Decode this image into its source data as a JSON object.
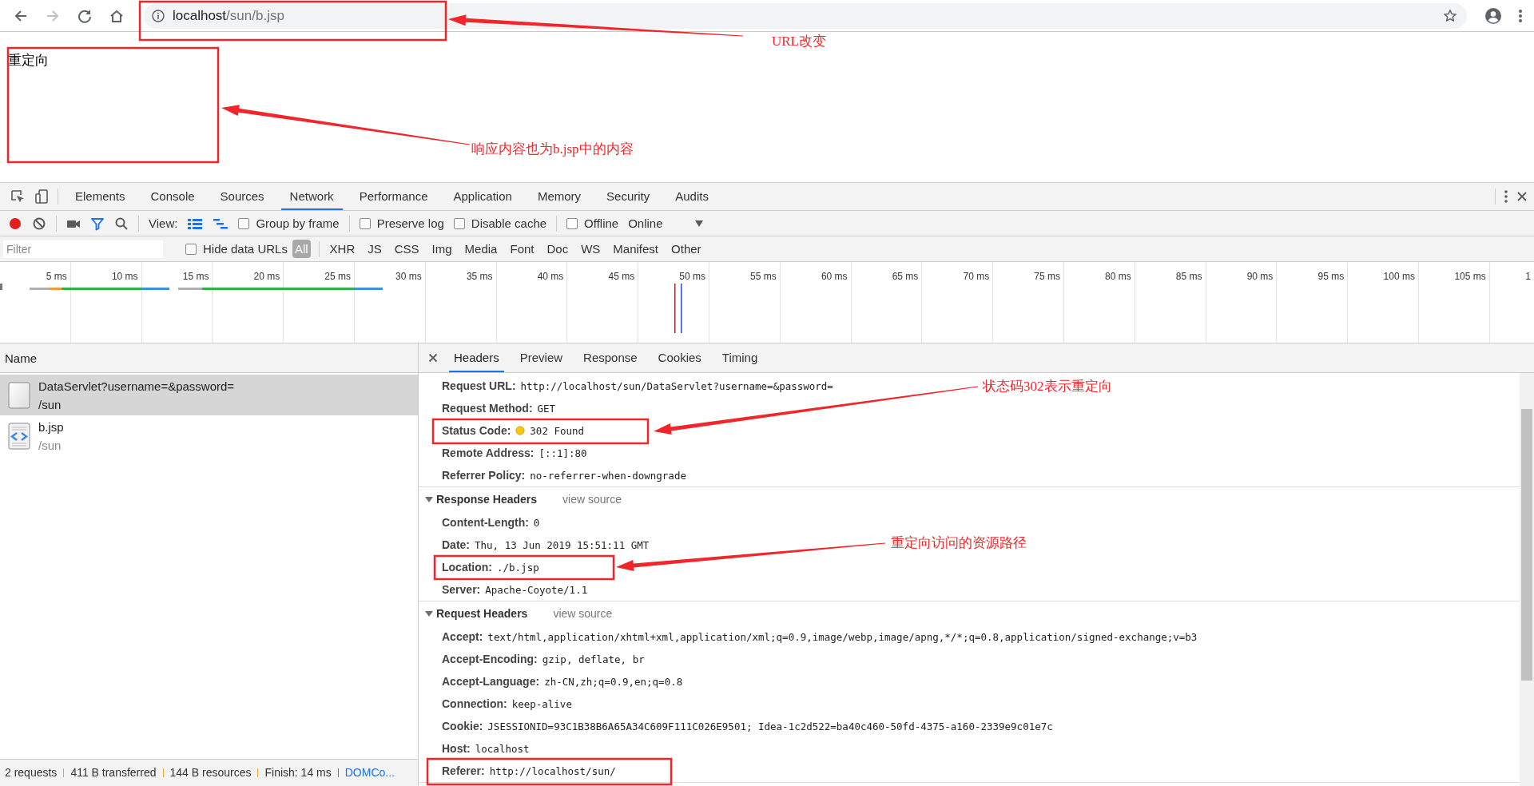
{
  "browser": {
    "url_host": "localhost",
    "url_path": "/sun/b.jsp"
  },
  "page": {
    "text": "重定向"
  },
  "devtools": {
    "tabs": [
      {
        "label": "Elements",
        "selected": false
      },
      {
        "label": "Console",
        "selected": false
      },
      {
        "label": "Sources",
        "selected": false
      },
      {
        "label": "Network",
        "selected": true
      },
      {
        "label": "Performance",
        "selected": false
      },
      {
        "label": "Application",
        "selected": false
      },
      {
        "label": "Memory",
        "selected": false
      },
      {
        "label": "Security",
        "selected": false
      },
      {
        "label": "Audits",
        "selected": false
      }
    ],
    "toolbar": {
      "recording": true,
      "view_label": "View:",
      "options": [
        {
          "label": "Group by frame",
          "checked": false
        },
        {
          "label": "Preserve log",
          "checked": false
        },
        {
          "label": "Disable cache",
          "checked": false
        },
        {
          "label": "Offline",
          "checked": false
        }
      ],
      "throttling": "Online"
    },
    "filter": {
      "placeholder": "Filter",
      "hide_data_urls": {
        "label": "Hide data URLs",
        "checked": false
      },
      "types": [
        {
          "label": "All",
          "selected": true
        },
        {
          "label": "XHR",
          "selected": false
        },
        {
          "label": "JS",
          "selected": false
        },
        {
          "label": "CSS",
          "selected": false
        },
        {
          "label": "Img",
          "selected": false
        },
        {
          "label": "Media",
          "selected": false
        },
        {
          "label": "Font",
          "selected": false
        },
        {
          "label": "Doc",
          "selected": false
        },
        {
          "label": "WS",
          "selected": false
        },
        {
          "label": "Manifest",
          "selected": false
        },
        {
          "label": "Other",
          "selected": false
        }
      ]
    },
    "timeline": {
      "ticks": [
        "5 ms",
        "10 ms",
        "15 ms",
        "20 ms",
        "25 ms",
        "30 ms",
        "35 ms",
        "40 ms",
        "45 ms",
        "50 ms",
        "55 ms",
        "60 ms",
        "65 ms",
        "70 ms",
        "75 ms",
        "80 ms",
        "85 ms",
        "90 ms",
        "95 ms",
        "100 ms",
        "105 ms",
        "1"
      ]
    },
    "requests": {
      "column": "Name",
      "rows": [
        {
          "name": "DataServlet?username=&password=",
          "path": "/sun",
          "kind": "document",
          "selected": true
        },
        {
          "name": "b.jsp",
          "path": "/sun",
          "kind": "html",
          "selected": false
        }
      ]
    },
    "status_bar": {
      "items": [
        "2 requests",
        "411 B transferred",
        "144 B resources",
        "Finish: 14 ms"
      ],
      "link": "DOMCo..."
    },
    "detail": {
      "tabs": [
        {
          "label": "Headers",
          "selected": true
        },
        {
          "label": "Preview",
          "selected": false
        },
        {
          "label": "Response",
          "selected": false
        },
        {
          "label": "Cookies",
          "selected": false
        },
        {
          "label": "Timing",
          "selected": false
        }
      ],
      "sections": [
        {
          "rows": [
            {
              "name": "Request URL:",
              "value": "http://localhost/sun/DataServlet?username=&password=",
              "kind": "text"
            },
            {
              "name": "Request Method:",
              "value": "GET",
              "kind": "text"
            },
            {
              "name": "Status Code:",
              "value": "302 Found",
              "kind": "status"
            },
            {
              "name": "Remote Address:",
              "value": "[::1]:80",
              "kind": "text"
            },
            {
              "name": "Referrer Policy:",
              "value": "no-referrer-when-downgrade",
              "kind": "text"
            }
          ]
        },
        {
          "title": "Response Headers",
          "view_source": "view source",
          "expanded": true,
          "rows": [
            {
              "name": "Content-Length:",
              "value": "0",
              "kind": "text"
            },
            {
              "name": "Date:",
              "value": "Thu, 13 Jun 2019 15:51:11 GMT",
              "kind": "text"
            },
            {
              "name": "Location:",
              "value": "./b.jsp",
              "kind": "text"
            },
            {
              "name": "Server:",
              "value": "Apache-Coyote/1.1",
              "kind": "text"
            }
          ]
        },
        {
          "title": "Request Headers",
          "view_source": "view source",
          "expanded": true,
          "rows": [
            {
              "name": "Accept:",
              "value": "text/html,application/xhtml+xml,application/xml;q=0.9,image/webp,image/apng,*/*;q=0.8,application/signed-exchange;v=b3",
              "kind": "text"
            },
            {
              "name": "Accept-Encoding:",
              "value": "gzip, deflate, br",
              "kind": "text"
            },
            {
              "name": "Accept-Language:",
              "value": "zh-CN,zh;q=0.9,en;q=0.8",
              "kind": "text"
            },
            {
              "name": "Connection:",
              "value": "keep-alive",
              "kind": "text"
            },
            {
              "name": "Cookie:",
              "value": "JSESSIONID=93C1B38B6A65A34C609F111C026E9501; Idea-1c2d522=ba40c460-50fd-4375-a160-2339e9c01e7c",
              "kind": "text"
            },
            {
              "name": "Host:",
              "value": "localhost",
              "kind": "text"
            },
            {
              "name": "Referer:",
              "value": "http://localhost/sun/",
              "kind": "text"
            }
          ]
        }
      ]
    }
  },
  "callouts": [
    {
      "text": "URL改变"
    },
    {
      "text": "响应内容也为b.jsp中的内容"
    },
    {
      "text": "状态码302表示重定向"
    },
    {
      "text": "重定向访问的资源路径"
    }
  ]
}
